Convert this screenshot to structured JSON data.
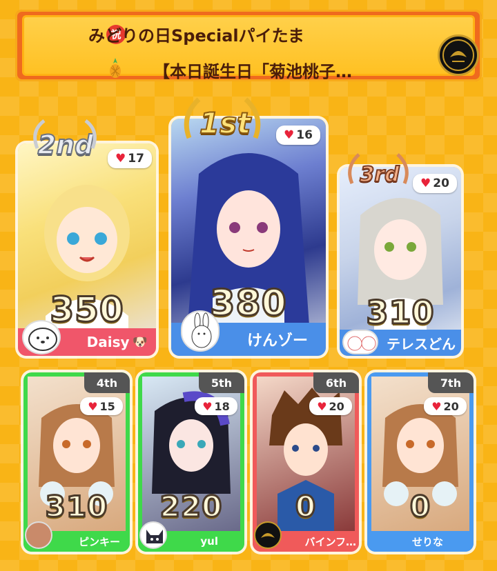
{
  "banner": {
    "title_line1": "みどりの日Specialパイたま",
    "title_line2": "【本日誕生日「菊池桃子…",
    "celebrate_glyph": "祝"
  },
  "top3": [
    {
      "rank_label": "2nd",
      "likes": "17",
      "score": "350",
      "name": "Daisy",
      "name_suffix_icon": "dog-icon"
    },
    {
      "rank_label": "1st",
      "likes": "16",
      "score": "380",
      "name": "けんゾー"
    },
    {
      "rank_label": "3rd",
      "likes": "20",
      "score": "310",
      "name": "テレスどん"
    }
  ],
  "others": [
    {
      "rank_label": "4th",
      "likes": "15",
      "score": "310",
      "name": "ピンキー"
    },
    {
      "rank_label": "5th",
      "likes": "18",
      "score": "220",
      "name": "yul"
    },
    {
      "rank_label": "6th",
      "likes": "20",
      "score": "0",
      "name": "バインフ…"
    },
    {
      "rank_label": "7th",
      "likes": "20",
      "score": "0",
      "name": "せりな"
    }
  ],
  "colors": {
    "background": "#f9b416",
    "banner": "#ef6a1e",
    "first_footer": "#4a8fe8",
    "second_footer": "#f0566a",
    "third_footer": "#4a8fe8",
    "green_card": "#3fd94a",
    "red_card": "#f05a5a",
    "blue_card": "#4a9af0",
    "heart": "#e8233a",
    "gold": "#e8b22a",
    "silver": "#c9ccd3",
    "bronze": "#d88a5a"
  }
}
